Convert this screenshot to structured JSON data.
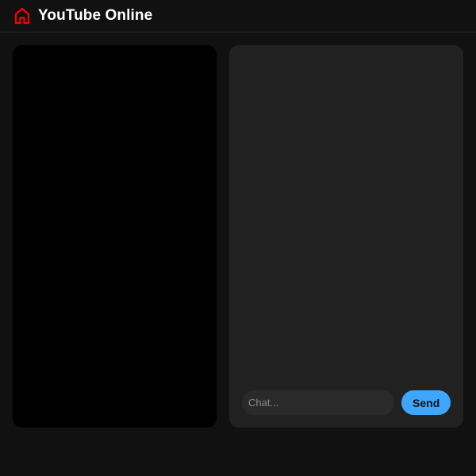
{
  "header": {
    "title": "YouTube Online",
    "home_icon": "home-icon"
  },
  "player": {},
  "chat": {
    "input": {
      "placeholder": "Chat...",
      "value": ""
    },
    "send_label": "Send",
    "messages": []
  },
  "colors": {
    "background": "#111111",
    "panel": "#212121",
    "player": "#000000",
    "input": "#2a2a2a",
    "accent": "#3ea6ff",
    "brand": "#ff0000"
  }
}
